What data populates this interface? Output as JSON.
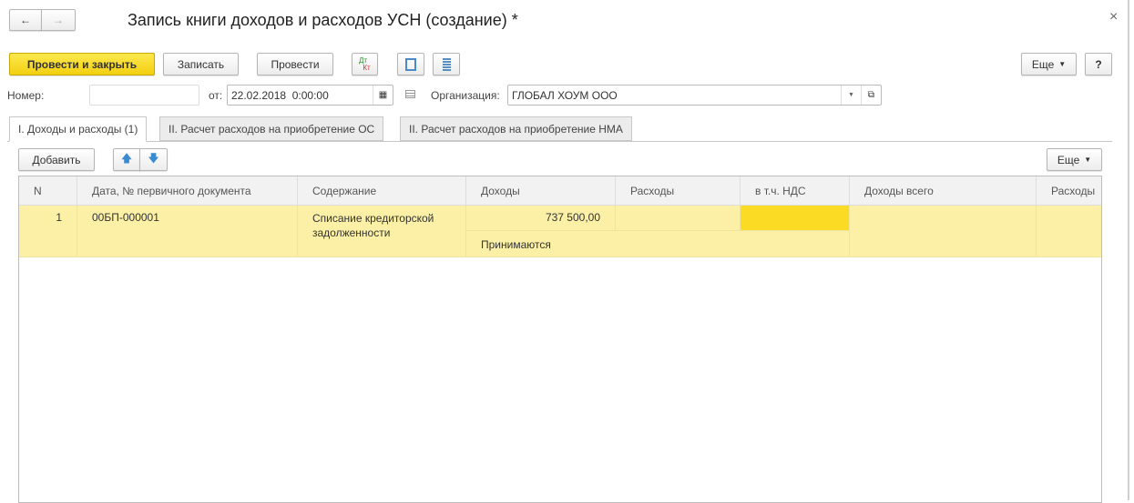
{
  "window": {
    "title": "Запись книги доходов и расходов УСН (создание) *",
    "close": "×"
  },
  "toolbar": {
    "post_close": "Провести и закрыть",
    "save": "Записать",
    "post": "Провести",
    "dtkt_dt": "Дт",
    "dtkt_kt": "Кт",
    "more": "Еще",
    "help": "?"
  },
  "form": {
    "number_label": "Номер:",
    "number_value": "",
    "date_label": "от:",
    "date_value": "22.02.2018  0:00:00",
    "org_label": "Организация:",
    "org_value": "ГЛОБАЛ ХОУМ ООО"
  },
  "tabs": [
    {
      "label": "I. Доходы и расходы (1)"
    },
    {
      "label": "II. Расчет расходов на приобретение ОС"
    },
    {
      "label": "II. Расчет расходов на приобретение НМА"
    }
  ],
  "table_toolbar": {
    "add": "Добавить",
    "more": "Еще"
  },
  "table": {
    "columns": [
      "N",
      "Дата, № первичного документа",
      "Содержание",
      "Доходы",
      "Расходы",
      "в т.ч. НДС",
      "Доходы всего",
      "Расходы"
    ],
    "rows": [
      {
        "n": "1",
        "doc": "00БП-000001",
        "content": "Списание кредиторской задолженности",
        "income": "737 500,00",
        "expense": "",
        "vat": "",
        "income_total": "",
        "expense_total": "",
        "income_note": "Принимаются"
      }
    ]
  }
}
